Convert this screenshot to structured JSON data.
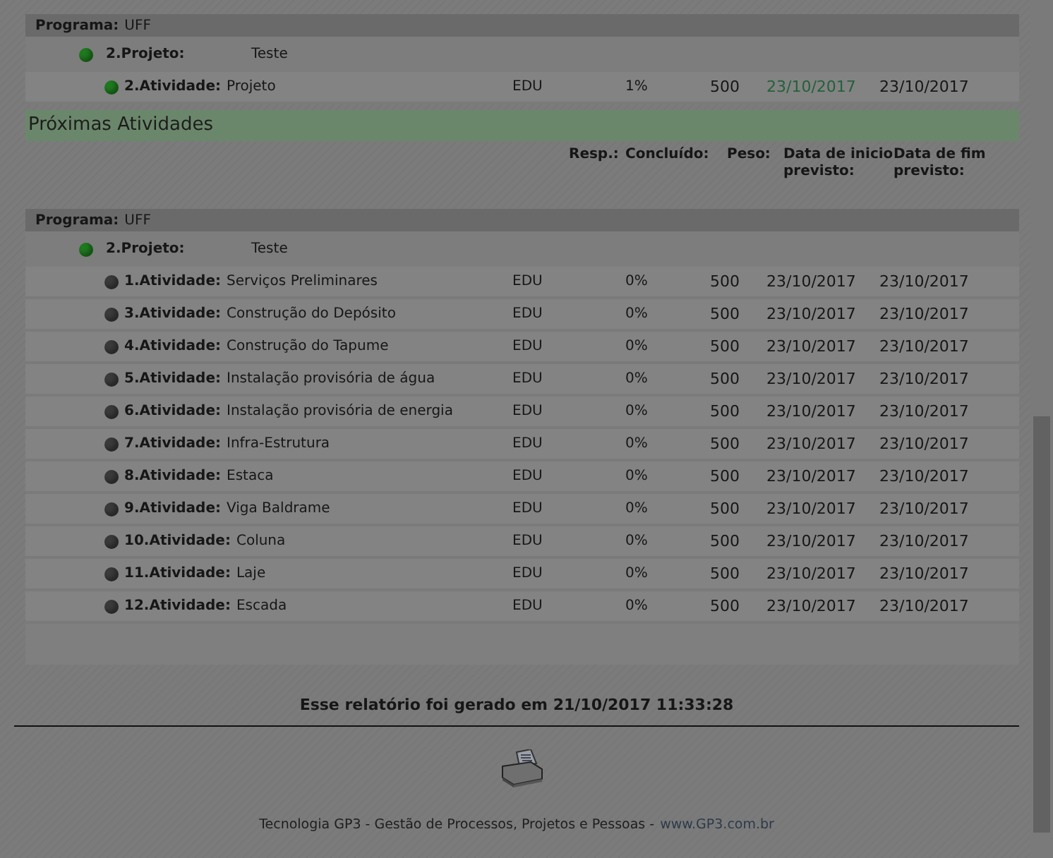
{
  "current": {
    "program": {
      "label": "Programa:",
      "name": "UFF"
    },
    "project": {
      "label": "2.Projeto:",
      "name": "Teste",
      "color": "#1e7a1e"
    },
    "activities": [
      {
        "label": "2.Atividade:",
        "name": "Projeto",
        "color": "#1e7a1e",
        "resp": "EDU",
        "done": "1%",
        "weight": "500",
        "start": "23/10/2017",
        "start_highlight": true,
        "end": "23/10/2017"
      }
    ]
  },
  "next": {
    "title": "Próximas Atividades",
    "columns": [
      "Resp.:",
      "Concluído:",
      "Peso:",
      "Data de inicio previsto:",
      "Data de fim previsto:"
    ],
    "program": {
      "label": "Programa:",
      "name": "UFF"
    },
    "project": {
      "label": "2.Projeto:",
      "name": "Teste",
      "color": "#1e7a1e"
    },
    "activities": [
      {
        "label": "1.Atividade:",
        "name": "Serviços Preliminares",
        "color": "#3a3a3a",
        "resp": "EDU",
        "done": "0%",
        "weight": "500",
        "start": "23/10/2017",
        "start_highlight": false,
        "end": "23/10/2017"
      },
      {
        "label": "3.Atividade:",
        "name": "Construção do Depósito",
        "color": "#3a3a3a",
        "resp": "EDU",
        "done": "0%",
        "weight": "500",
        "start": "23/10/2017",
        "start_highlight": false,
        "end": "23/10/2017"
      },
      {
        "label": "4.Atividade:",
        "name": "Construção do Tapume",
        "color": "#3a3a3a",
        "resp": "EDU",
        "done": "0%",
        "weight": "500",
        "start": "23/10/2017",
        "start_highlight": false,
        "end": "23/10/2017"
      },
      {
        "label": "5.Atividade:",
        "name": "Instalação provisória de água",
        "color": "#3a3a3a",
        "resp": "EDU",
        "done": "0%",
        "weight": "500",
        "start": "23/10/2017",
        "start_highlight": false,
        "end": "23/10/2017"
      },
      {
        "label": "6.Atividade:",
        "name": "Instalação provisória de energia",
        "color": "#3a3a3a",
        "resp": "EDU",
        "done": "0%",
        "weight": "500",
        "start": "23/10/2017",
        "start_highlight": false,
        "end": "23/10/2017"
      },
      {
        "label": "7.Atividade:",
        "name": "Infra-Estrutura",
        "color": "#3a3a3a",
        "resp": "EDU",
        "done": "0%",
        "weight": "500",
        "start": "23/10/2017",
        "start_highlight": false,
        "end": "23/10/2017"
      },
      {
        "label": "8.Atividade:",
        "name": "Estaca",
        "color": "#3a3a3a",
        "resp": "EDU",
        "done": "0%",
        "weight": "500",
        "start": "23/10/2017",
        "start_highlight": false,
        "end": "23/10/2017"
      },
      {
        "label": "9.Atividade:",
        "name": "Viga Baldrame",
        "color": "#3a3a3a",
        "resp": "EDU",
        "done": "0%",
        "weight": "500",
        "start": "23/10/2017",
        "start_highlight": false,
        "end": "23/10/2017"
      },
      {
        "label": "10.Atividade:",
        "name": "Coluna",
        "color": "#3a3a3a",
        "resp": "EDU",
        "done": "0%",
        "weight": "500",
        "start": "23/10/2017",
        "start_highlight": false,
        "end": "23/10/2017"
      },
      {
        "label": "11.Atividade:",
        "name": "Laje",
        "color": "#3a3a3a",
        "resp": "EDU",
        "done": "0%",
        "weight": "500",
        "start": "23/10/2017",
        "start_highlight": false,
        "end": "23/10/2017"
      },
      {
        "label": "12.Atividade:",
        "name": "Escada",
        "color": "#3a3a3a",
        "resp": "EDU",
        "done": "0%",
        "weight": "500",
        "start": "23/10/2017",
        "start_highlight": false,
        "end": "23/10/2017"
      }
    ]
  },
  "generated": "Esse relatório foi gerado em 21/10/2017 11:33:28",
  "footer": {
    "text": "Tecnologia GP3 - Gestão de Processos, Projetos e Pessoas -",
    "link": "www.GP3.com.br"
  }
}
